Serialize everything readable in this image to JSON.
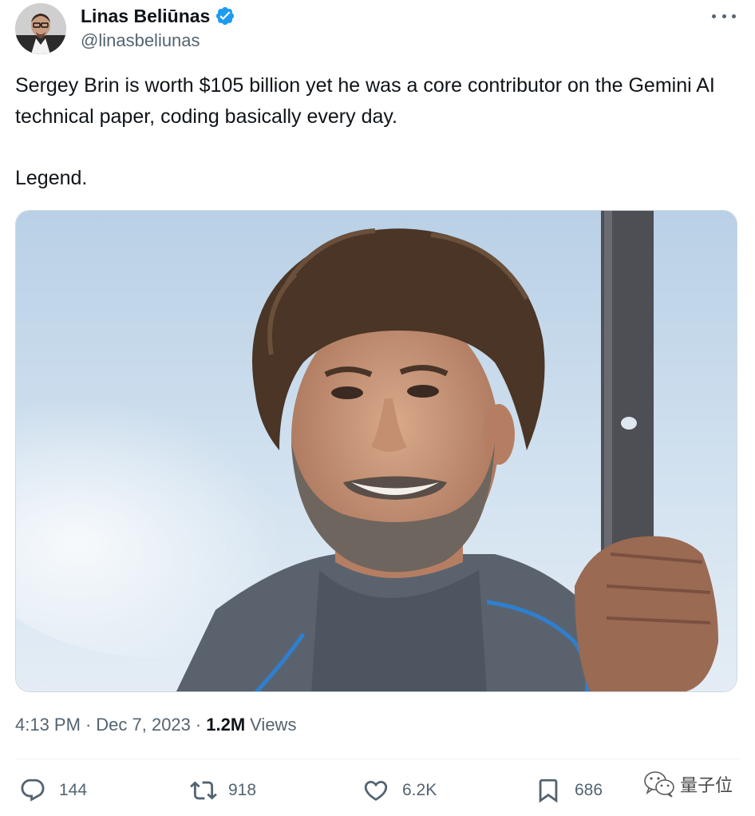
{
  "author": {
    "name": "Linas Beliūnas",
    "handle": "@linasbeliunas",
    "verified": true,
    "verified_color": "#1d9bf0"
  },
  "tweet": {
    "paragraphs": [
      "Sergey Brin is worth $105 billion yet he was a core contributor on the Gemini AI technical paper, coding basically every day.",
      "Legend."
    ]
  },
  "meta": {
    "time": "4:13 PM",
    "separator": "·",
    "date": "Dec 7, 2023",
    "views_count": "1.2M",
    "views_label": "Views"
  },
  "actions": {
    "replies": {
      "icon": "reply-icon",
      "count": "144"
    },
    "reposts": {
      "icon": "repost-icon",
      "count": "918"
    },
    "likes": {
      "icon": "like-icon",
      "count": "6.2K"
    },
    "bookmarks": {
      "icon": "bookmark-icon",
      "count": "686"
    }
  },
  "watermark": {
    "icon": "wechat-icon",
    "text": "量子位"
  },
  "colors": {
    "text": "#0f1419",
    "secondary": "#536471",
    "divider": "#eff3f4"
  }
}
